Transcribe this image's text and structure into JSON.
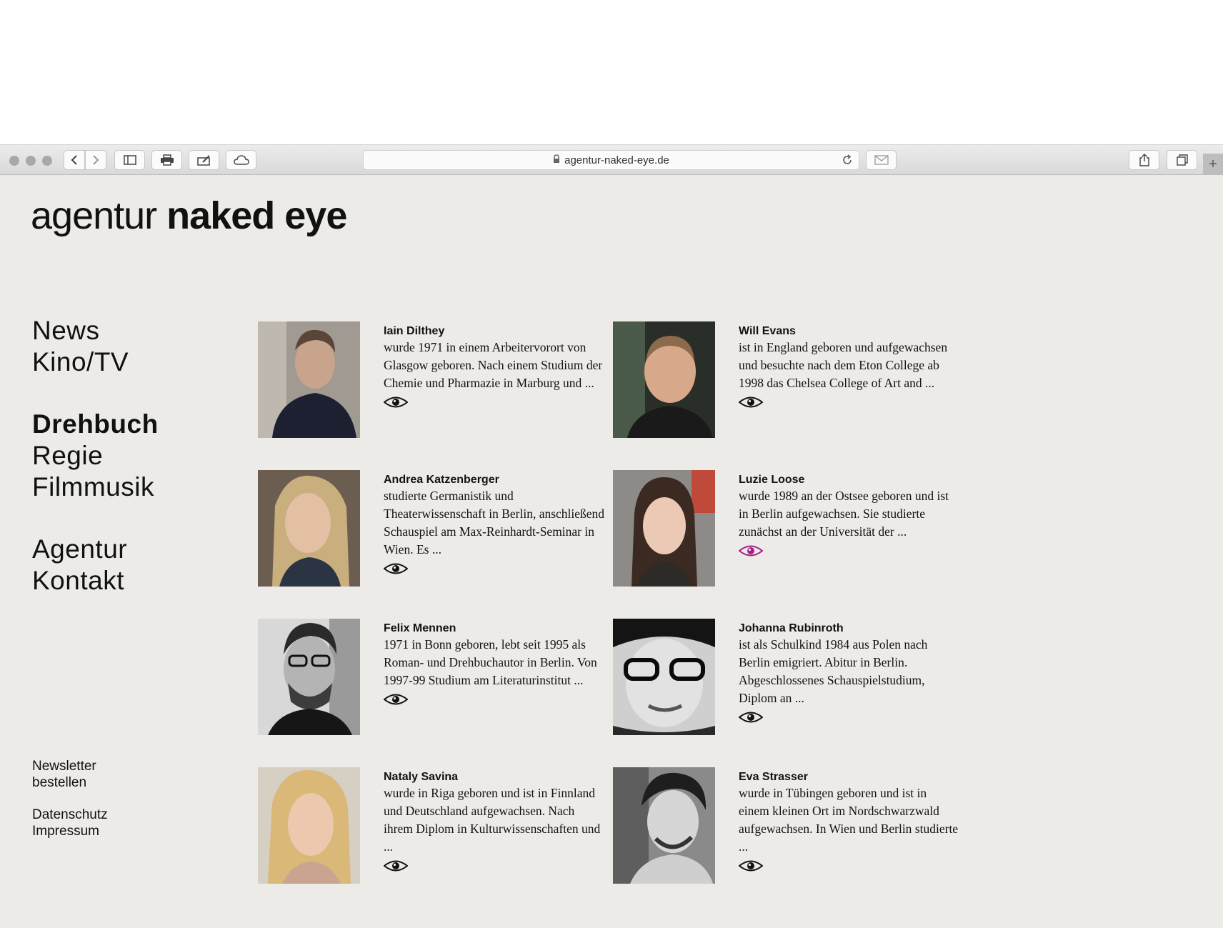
{
  "browser": {
    "url": "agentur-naked-eye.de",
    "new_tab_glyph": "+"
  },
  "site": {
    "logo_light": "agentur",
    "logo_bold_1": "naked",
    "logo_bold_2": "eye"
  },
  "nav": {
    "news": "News",
    "kino_tv": "Kino/TV",
    "drehbuch": "Drehbuch",
    "regie": "Regie",
    "filmmusik": "Filmmusik",
    "agentur": "Agentur",
    "kontakt": "Kontakt",
    "active": "Drehbuch"
  },
  "footer_nav": {
    "newsletter_line1": "Newsletter",
    "newsletter_line2": "bestellen",
    "datenschutz": "Datenschutz",
    "impressum": "Impressum"
  },
  "colors": {
    "page_bg": "#ecebe7",
    "eye_default": "#111111",
    "eye_hover": "#a3208a"
  },
  "people": [
    {
      "name": "Iain Dilthey",
      "bio": "wurde 1971 in einem Arbeitervorort von Glasgow geboren. Nach einem Studium der Chemie und Pharmazie in Marburg und ...",
      "icon": "eye-icon",
      "highlighted": false
    },
    {
      "name": "Will Evans",
      "bio": "ist in England geboren und aufgewachsen und besuchte nach dem Eton College ab 1998 das Chelsea College of Art and ...",
      "icon": "eye-icon",
      "highlighted": false
    },
    {
      "name": "Andrea Katzenberger",
      "bio": "studierte Germanistik und Theaterwissenschaft in Berlin, anschließend Schauspiel am Max-Reinhardt-Seminar in Wien. Es ...",
      "icon": "eye-icon",
      "highlighted": false
    },
    {
      "name": "Luzie Loose",
      "bio": "wurde 1989 an der Ostsee geboren und ist in Berlin aufgewachsen. Sie studierte zunächst an der Universität der ...",
      "icon": "eye-icon",
      "highlighted": true
    },
    {
      "name": "Felix Mennen",
      "bio": "1971 in Bonn geboren, lebt seit 1995 als Roman- und Drehbuchautor in Berlin. Von 1997-99 Studium am Literaturinstitut ...",
      "icon": "eye-icon",
      "highlighted": false
    },
    {
      "name": "Johanna Rubinroth",
      "bio": "ist als Schulkind 1984 aus Polen nach Berlin emigriert. Abitur in Berlin. Abgeschlossenes Schauspielstudium, Diplom an ...",
      "icon": "eye-icon",
      "highlighted": false
    },
    {
      "name": "Nataly Savina",
      "bio": "wurde in Riga geboren und ist in Finnland und Deutschland aufgewachsen. Nach ihrem Diplom in Kulturwissenschaften und ...",
      "icon": "eye-icon",
      "highlighted": false
    },
    {
      "name": "Eva Strasser",
      "bio": "wurde in Tübingen geboren und ist in einem kleinen Ort im Nordschwarzwald aufgewachsen. In Wien und Berlin studierte ...",
      "icon": "eye-icon",
      "highlighted": false
    }
  ]
}
